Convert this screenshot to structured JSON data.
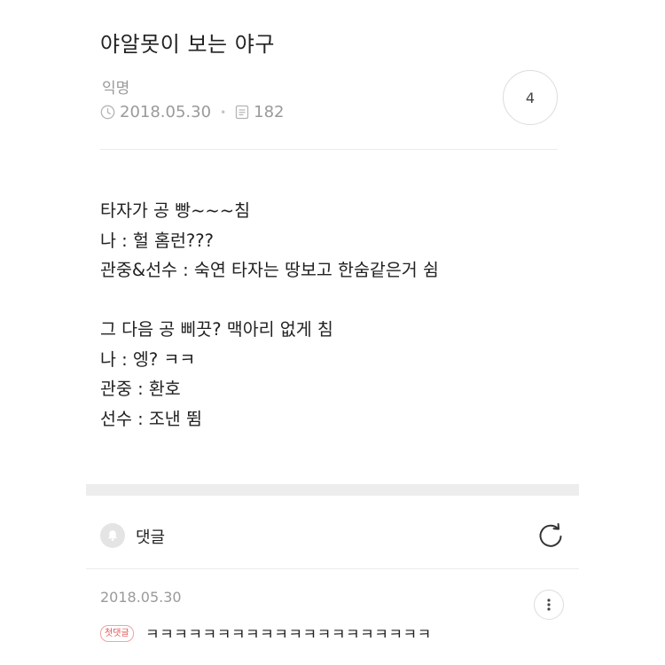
{
  "post": {
    "title": "야알못이 보는 야구",
    "author": "익명",
    "date": "2018.05.30",
    "separator": "•",
    "views": "182",
    "comment_count": "4",
    "body_lines": [
      "타자가 공 빵~~~침",
      "나 : 헐 홈런???",
      "관중&선수 : 숙연 타자는 땅보고 한숨같은거 쉼",
      "",
      "그 다음 공 삐끗? 맥아리 없게 침",
      "나 : 엥? ㅋㅋ",
      "관중 : 환호",
      "선수 : 조낸 뜀"
    ]
  },
  "comments": {
    "label": "댓글",
    "first": {
      "date": "2018.05.30",
      "badge": "첫댓글",
      "text": "ㅋㅋㅋㅋㅋㅋㅋㅋㅋㅋㅋㅋㅋㅋㅋㅋㅋㅋㅋㅋ"
    }
  },
  "icons": {
    "clock": "clock-icon",
    "views": "document-icon",
    "bell": "bell-icon",
    "refresh": "refresh-icon",
    "more": "more-vertical-icon"
  },
  "colors": {
    "text": "#222222",
    "muted": "#9a9a9a",
    "badge": "#e05555",
    "band": "#ededed"
  }
}
